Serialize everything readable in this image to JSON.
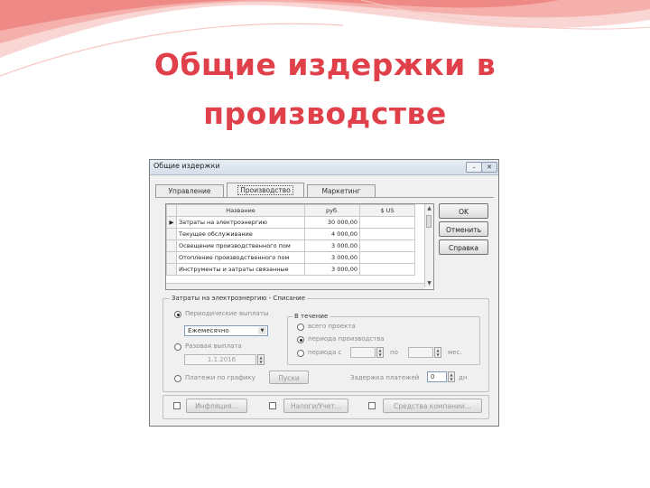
{
  "slide": {
    "title_line1": "Общие издержки в",
    "title_line2": "производстве",
    "title_color": "#e0404a"
  },
  "dialog": {
    "title": "Общие издержки",
    "minimize_icon": "minimize-icon",
    "close_icon": "close-icon",
    "close_glyph": "✕",
    "minimize_glyph": "–",
    "tabs": [
      "Управление",
      "Производство",
      "Маркетинг"
    ],
    "active_tab": "Производство",
    "grid": {
      "headers": [
        "Название",
        "руб.",
        "$ US"
      ],
      "rows": [
        {
          "name": "Затраты на электроэнергию",
          "rub": "30 000,00",
          "usd": ""
        },
        {
          "name": "Текущее обслуживание",
          "rub": "4 000,00",
          "usd": ""
        },
        {
          "name": "Освещение производственного пом",
          "rub": "3 000,00",
          "usd": ""
        },
        {
          "name": "Отопление производственного пом",
          "rub": "3 000,00",
          "usd": ""
        },
        {
          "name": "Инструменты и затраты связанные",
          "rub": "3 000,00",
          "usd": ""
        }
      ]
    },
    "buttons": {
      "ok": "OK",
      "cancel": "Отменить",
      "help": "Справка"
    },
    "writeoff_group": {
      "label": "Затраты на электроэнергию - Списание",
      "periodic_label": "Периодические выплаты",
      "periodic_selected": true,
      "frequency_value": "Ежемесячно",
      "one_time_label": "Разовая выплата",
      "one_time_value": "1.1.2016",
      "schedule_label": "Платежи по графику",
      "schedule_button": "Пуски",
      "during_group": {
        "label": "В течение",
        "option_whole_project": "всего проекта",
        "option_production_period": "периода производства",
        "option_period": "периода с",
        "selected": "периода производства",
        "to_label": "по",
        "months_label": "мес."
      },
      "payment_delay_label": "Задержка платежей",
      "payment_delay_value": "0",
      "payment_delay_unit": "дн"
    },
    "bottom": {
      "inflation_label": "Инфляция...",
      "taxes_label": "Налоги/Учет...",
      "company_assets_label": "Средства компании..."
    }
  }
}
